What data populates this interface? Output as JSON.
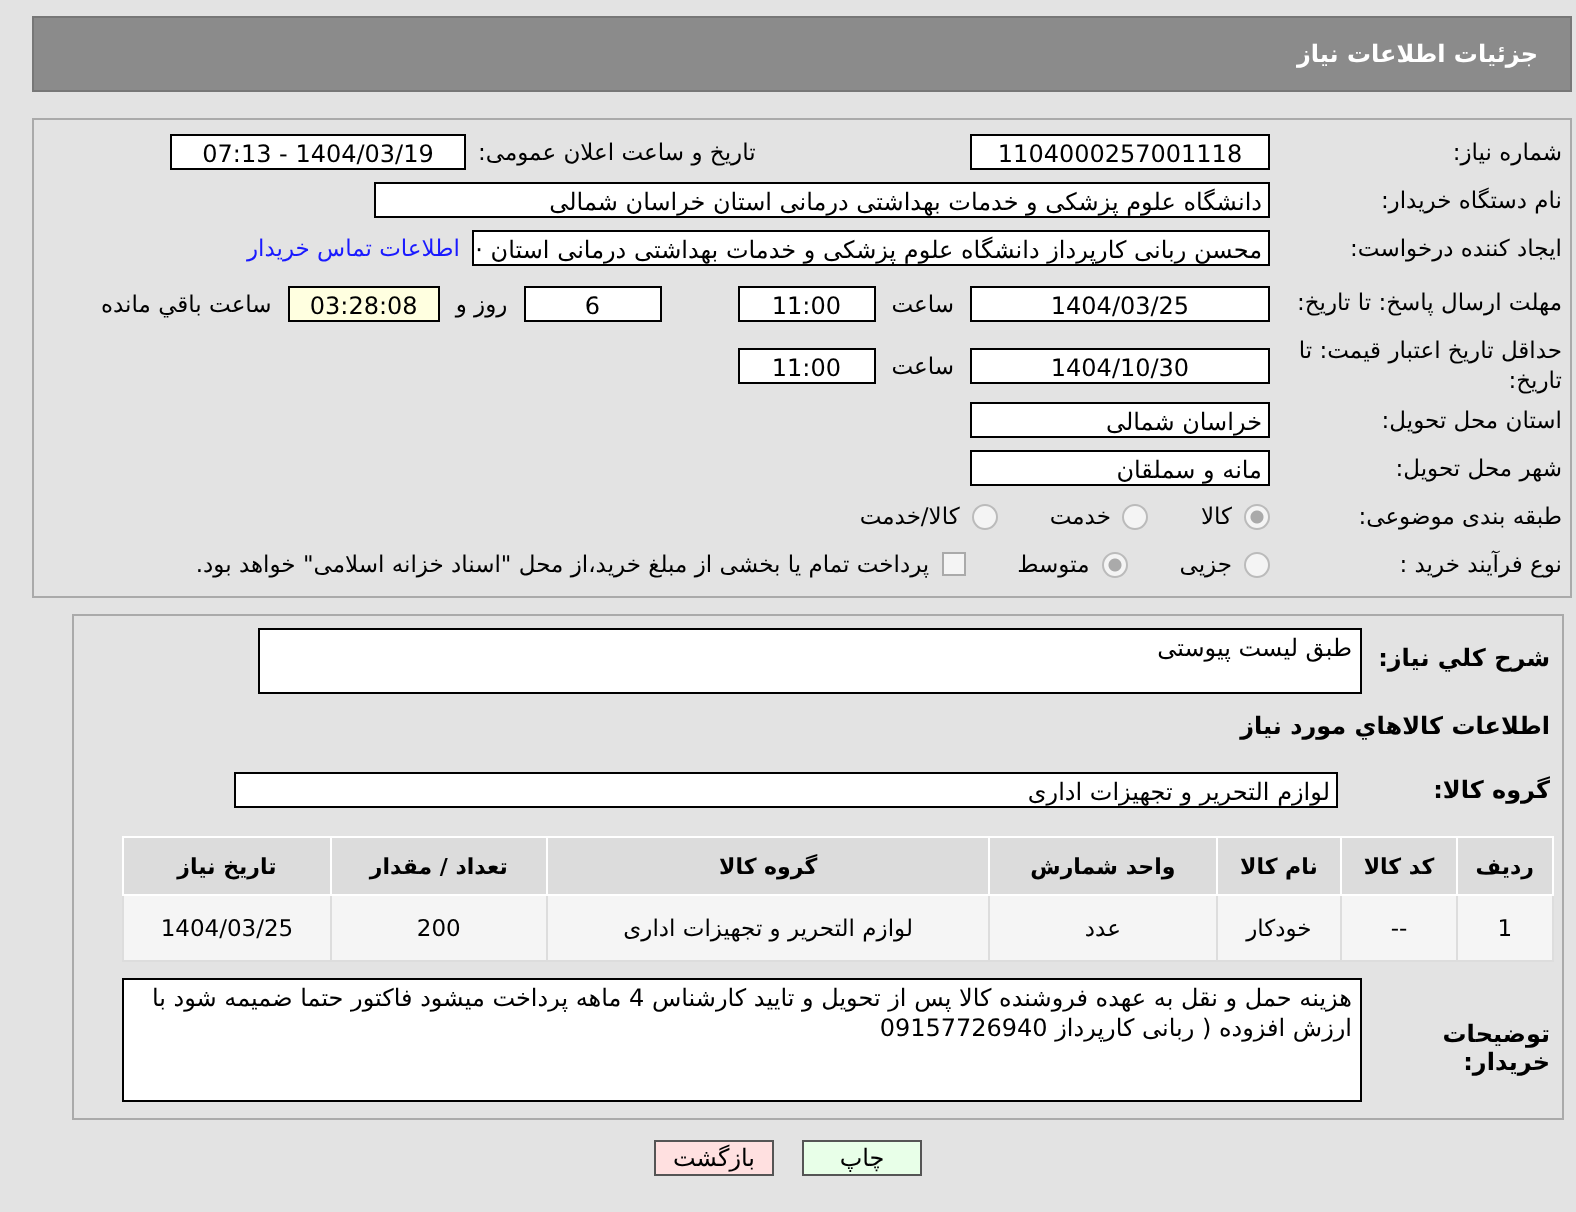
{
  "header": {
    "title": "جزئیات اطلاعات نیاز"
  },
  "details": {
    "need_number": {
      "label": "شماره نیاز:",
      "value": "1104000257001118"
    },
    "announce": {
      "label": "تاریخ و ساعت اعلان عمومی:",
      "value": "1404/03/19 - 07:13"
    },
    "buyer": {
      "label": "نام دستگاه خریدار:",
      "value": "دانشگاه علوم پزشکی و خدمات بهداشتی درمانی استان خراسان شمالی"
    },
    "creator": {
      "label": "ایجاد کننده درخواست:",
      "value": "محسن ربانی کارپرداز دانشگاه علوم پزشکی و خدمات بهداشتی درمانی استان ·",
      "link": "اطلاعات تماس خریدار"
    },
    "deadline": {
      "label": "مهلت ارسال پاسخ: تا تاریخ:",
      "date": "1404/03/25",
      "time_label": "ساعت",
      "time": "11:00",
      "days": "6",
      "days_label": "روز و",
      "remaining": "03:28:08",
      "remaining_label": "ساعت باقي مانده"
    },
    "validity": {
      "label": "حداقل تاریخ اعتبار قیمت: تا تاریخ:",
      "date": "1404/10/30",
      "time_label": "ساعت",
      "time": "11:00"
    },
    "province": {
      "label": "استان محل تحویل:",
      "value": "خراسان شمالی"
    },
    "city": {
      "label": "شهر محل تحویل:",
      "value": "مانه و سملقان"
    },
    "category": {
      "label": "طبقه بندی موضوعی:",
      "options": [
        {
          "label": "کالا",
          "selected": true
        },
        {
          "label": "خدمت",
          "selected": false
        },
        {
          "label": "کالا/خدمت",
          "selected": false
        }
      ]
    },
    "process": {
      "label": "نوع فرآیند خرید :",
      "options": [
        {
          "label": "جزیی",
          "selected": false
        },
        {
          "label": "متوسط",
          "selected": true
        }
      ],
      "treasury": {
        "label": "پرداخت تمام یا بخشی از مبلغ خرید،از محل \"اسناد خزانه اسلامی\" خواهد بود.",
        "checked": false
      }
    }
  },
  "summary": {
    "label": "شرح کلي نياز:",
    "value": "طبق لیست پیوستی"
  },
  "goods_title": "اطلاعات کالاهاي مورد نياز",
  "goods_group": {
    "label": "گروه کالا:",
    "value": "لوازم التحریر و تجهیزات اداری"
  },
  "table": {
    "columns": [
      "ردیف",
      "کد کالا",
      "نام کالا",
      "واحد شمارش",
      "گروه کالا",
      "تعداد / مقدار",
      "تاریخ نیاز"
    ],
    "rows": [
      [
        "1",
        "--",
        "خودکار",
        "عدد",
        "لوازم التحریر و تجهیزات اداری",
        "200",
        "1404/03/25"
      ]
    ]
  },
  "buyer_notes": {
    "label": "توضیحات خریدار:",
    "value": "هزینه حمل و نقل به عهده فروشنده کالا پس از تحویل و تایید کارشناس 4 ماهه پرداخت میشود فاکتور حتما ضمیمه شود با ارزش افزوده ( ربانی کارپرداز 09157726940"
  },
  "buttons": [
    {
      "label": "چاپ",
      "kind": "print"
    },
    {
      "label": "بازگشت",
      "kind": "back"
    }
  ]
}
